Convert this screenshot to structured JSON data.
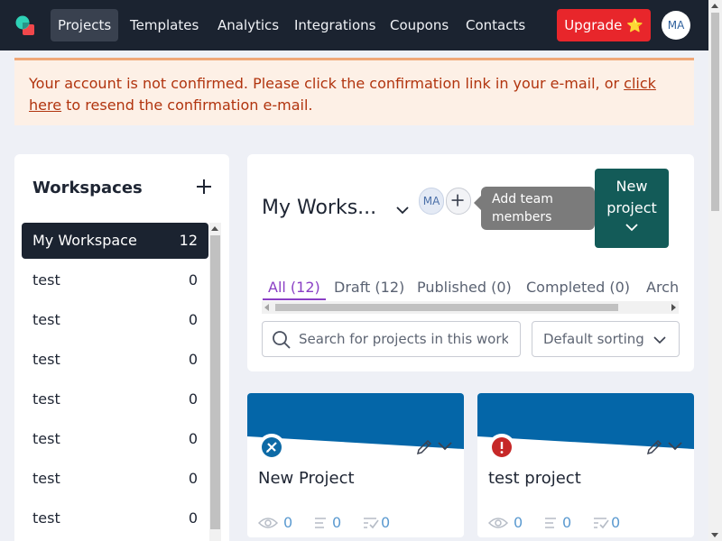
{
  "nav": {
    "items": [
      "Projects",
      "Templates",
      "Analytics",
      "Integrations",
      "Coupons",
      "Contacts"
    ],
    "active": "Projects",
    "upgrade_label": "Upgrade ⭐",
    "avatar_initials": "MA"
  },
  "alert": {
    "text_before": "Your account is not confirmed. Please click the confirmation link in your e-mail, or ",
    "link_text": "click here",
    "text_after": " to resend the confirmation e-mail."
  },
  "workspaces": {
    "title": "Workspaces",
    "items": [
      {
        "name": "My Workspace",
        "count": "12",
        "active": true
      },
      {
        "name": "test",
        "count": "0"
      },
      {
        "name": "test",
        "count": "0"
      },
      {
        "name": "test",
        "count": "0"
      },
      {
        "name": "test",
        "count": "0"
      },
      {
        "name": "test",
        "count": "0"
      },
      {
        "name": "test",
        "count": "0"
      },
      {
        "name": "test",
        "count": "0"
      }
    ]
  },
  "main": {
    "workspace_name": "My Works...",
    "team_avatar": "MA",
    "tooltip": "Add team members",
    "new_project_label": "New project",
    "tabs": [
      {
        "label": "All (12)",
        "active": true
      },
      {
        "label": "Draft (12)"
      },
      {
        "label": "Published (0)"
      },
      {
        "label": "Completed (0)"
      },
      {
        "label": "Archived"
      }
    ],
    "search_placeholder": "Search for projects in this workspace",
    "sort_value": "Default sorting"
  },
  "projects": [
    {
      "title": "New Project",
      "views": "0",
      "responses": "0",
      "completions": "0",
      "badge_icon": "design-tools-icon",
      "badge_color": "#0d6aa6"
    },
    {
      "title": "test project",
      "views": "0",
      "responses": "0",
      "completions": "0",
      "badge_icon": "alert-icon",
      "badge_color": "#c62828"
    }
  ],
  "colors": {
    "nav_bg": "#1b2330",
    "accent_blue": "#0466a8",
    "new_project_bg": "#135b58",
    "upgrade_bg": "#e8262b",
    "tab_active": "#8a3fc5"
  }
}
